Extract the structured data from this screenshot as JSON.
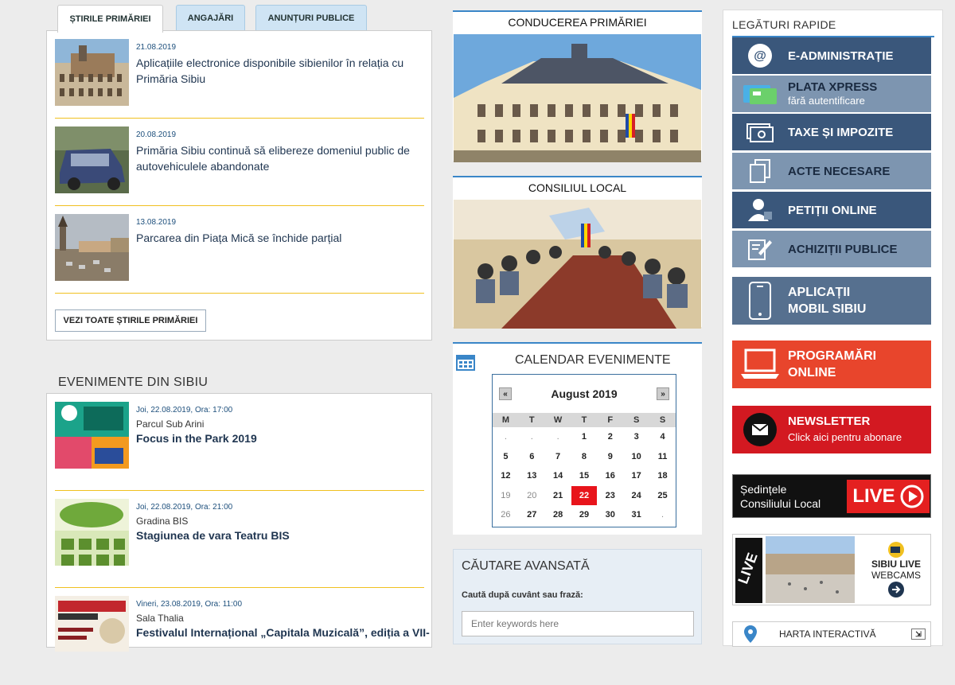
{
  "tabs": [
    "ȘTIRILE PRIMĂRIEI",
    "ANGAJĂRI",
    "ANUNȚURI PUBLICE"
  ],
  "news": [
    {
      "date": "21.08.2019",
      "title": "Aplicațiile electronice disponibile sibienilor în relația cu Primăria Sibiu"
    },
    {
      "date": "20.08.2019",
      "title": "Primăria Sibiu continuă să elibereze domeniul public de autovehiculele abandonate"
    },
    {
      "date": "13.08.2019",
      "title": "Parcarea din Piața Mică se închide parțial"
    }
  ],
  "all_news_button": "VEZI TOATE ȘTIRILE PRIMĂRIEI",
  "events_heading": "EVENIMENTE DIN SIBIU",
  "events": [
    {
      "date": "Joi, 22.08.2019, Ora: 17:00",
      "place": "Parcul Sub Arini",
      "title": "Focus in the Park 2019"
    },
    {
      "date": "Joi, 22.08.2019, Ora: 21:00",
      "place": "Gradina BIS",
      "title": "Stagiunea de vara Teatru BIS"
    },
    {
      "date": "Vineri, 23.08.2019, Ora: 11:00",
      "place": "Sala Thalia",
      "title": "Festivalul Internațional „Capitala Muzicală”, ediția a VII-"
    }
  ],
  "leadership_heading": "CONDUCEREA PRIMĂRIEI",
  "council_heading": "CONSILIUL LOCAL",
  "calendar": {
    "heading": "CALENDAR EVENIMENTE",
    "month": "August 2019",
    "prev": "«",
    "next": "»",
    "weekdays": [
      "M",
      "T",
      "W",
      "T",
      "F",
      "S",
      "S"
    ],
    "weeks": [
      [
        ".",
        ".",
        ".",
        "1",
        "2",
        "3",
        "4"
      ],
      [
        "5",
        "6",
        "7",
        "8",
        "9",
        "10",
        "11"
      ],
      [
        "12",
        "13",
        "14",
        "15",
        "16",
        "17",
        "18"
      ],
      [
        "19",
        "20",
        "21",
        "22",
        "23",
        "24",
        "25"
      ],
      [
        "26",
        "27",
        "28",
        "29",
        "30",
        "31",
        "."
      ]
    ],
    "today": "22"
  },
  "search": {
    "heading": "CĂUTARE AVANSATĂ",
    "label": "Caută după cuvânt sau frază:",
    "placeholder": "Enter keywords here"
  },
  "quick": {
    "heading": "LEGĂTURI RAPIDE",
    "links": [
      {
        "label": "E-ADMINISTRAȚIE",
        "icon": "at-icon"
      },
      {
        "label": "PLATA XPRESS",
        "sub": "fără autentificare",
        "icon": "card-icon"
      },
      {
        "label": "TAXE ȘI IMPOZITE",
        "icon": "money-icon"
      },
      {
        "label": "ACTE NECESARE",
        "icon": "documents-icon"
      },
      {
        "label": "PETIȚII ONLINE",
        "icon": "user-icon"
      },
      {
        "label": "ACHIZIȚII PUBLICE",
        "icon": "edit-icon"
      }
    ],
    "mobile": {
      "line1": "APLICAȚII",
      "line2": "MOBIL SIBIU"
    },
    "programari": {
      "line1": "PROGRAMĂRI",
      "line2": "ONLINE"
    },
    "newsletter": {
      "title": "NEWSLETTER",
      "sub": "Click aici pentru abonare"
    },
    "live": {
      "line1": "Ședințele",
      "line2": "Consiliului Local",
      "badge": "LIVE"
    },
    "webcams": {
      "line1": "SIBIU LIVE",
      "line2": "WEBCAMS",
      "logo": "LIVE"
    },
    "map": "HARTA INTERACTIVĂ"
  }
}
